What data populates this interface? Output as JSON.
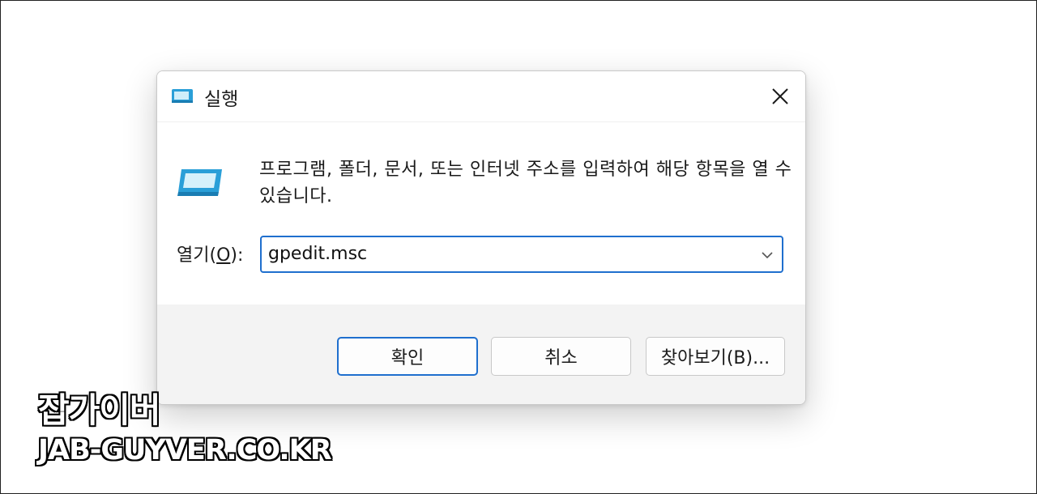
{
  "dialog": {
    "title": "실행",
    "title_icon": "run-icon",
    "close_icon": "close-icon",
    "message": "프로그램, 폴더, 문서, 또는 인터넷 주소를 입력하여 해당 항목을 열 수 있습니다.",
    "open_label_prefix": "열기(",
    "open_label_accel": "O",
    "open_label_suffix": "):",
    "open_value": "gpedit.msc",
    "buttons": {
      "ok": "확인",
      "cancel": "취소",
      "browse": "찾아보기(B)..."
    }
  },
  "watermark": {
    "line1": "잡가이버",
    "line2": "JAB-GUYVER.CO.KR"
  },
  "colors": {
    "accent": "#1f6fce",
    "footer_bg": "#f3f3f3",
    "icon_blue": "#2a9fd8"
  }
}
